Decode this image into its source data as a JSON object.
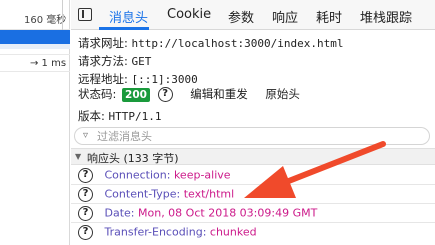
{
  "timeline": {
    "row1_time": "160 毫秒",
    "row2_time": "→ 1 ms"
  },
  "tabs": [
    "消息头",
    "Cookie",
    "参数",
    "响应",
    "耗时",
    "堆栈跟踪"
  ],
  "request": {
    "url_label": "请求网址:",
    "url_value": "http://localhost:3000/index.html",
    "method_label": "请求方法:",
    "method_value": "GET",
    "remote_label": "远程地址:",
    "remote_value": "[::1]:3000",
    "status_label": "状态码:",
    "status_value": "200",
    "edit_resend": "编辑和重发",
    "raw_headers": "原始头",
    "version_label": "版本:",
    "version_value": "HTTP/1.1"
  },
  "filter": {
    "placeholder": "过滤消息头"
  },
  "response_section": {
    "title": "响应头 (133 字节)"
  },
  "response_headers": [
    {
      "name": "Connection:",
      "value": "keep-alive"
    },
    {
      "name": "Content-Type:",
      "value": "text/html"
    },
    {
      "name": "Date:",
      "value": "Mon, 08 Oct 2018 03:09:49 GMT"
    },
    {
      "name": "Transfer-Encoding:",
      "value": "chunked"
    }
  ],
  "colors": {
    "accent": "#1a73e8",
    "status_ok": "#1a9a3c",
    "header_key": "#5a4fb8",
    "header_value": "#cc1a8a",
    "annotation_arrow": "#f04a2b"
  }
}
